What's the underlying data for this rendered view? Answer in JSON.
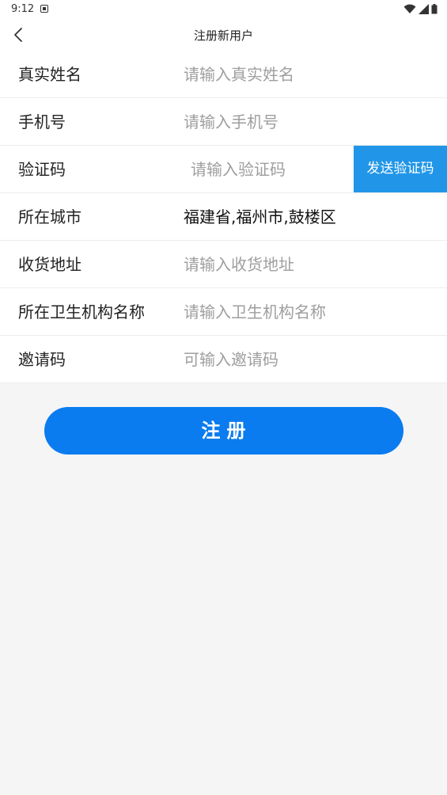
{
  "status_bar": {
    "time": "9:12"
  },
  "nav": {
    "title": "注册新用户"
  },
  "form": {
    "rows": [
      {
        "label": "真实姓名",
        "placeholder": "请输入真实姓名"
      },
      {
        "label": "手机号",
        "placeholder": "请输入手机号"
      },
      {
        "label": "验证码",
        "placeholder": "请输入验证码",
        "button": "发送验证码"
      },
      {
        "label": "所在城市",
        "value": "福建省,福州市,鼓楼区"
      },
      {
        "label": "收货地址",
        "placeholder": "请输入收货地址"
      },
      {
        "label": "所在卫生机构名称",
        "placeholder": "请输入卫生机构名称"
      },
      {
        "label": "邀请码",
        "placeholder": "可输入邀请码"
      }
    ]
  },
  "submit": {
    "label": "注册"
  },
  "colors": {
    "accent": "#0a7cf0",
    "send_code": "#2196e8",
    "background": "#f5f5f5"
  },
  "icons": {
    "back": "chevron-left-icon",
    "wifi": "wifi-icon",
    "signal": "signal-icon",
    "battery": "battery-icon",
    "notification": "notification-icon"
  }
}
